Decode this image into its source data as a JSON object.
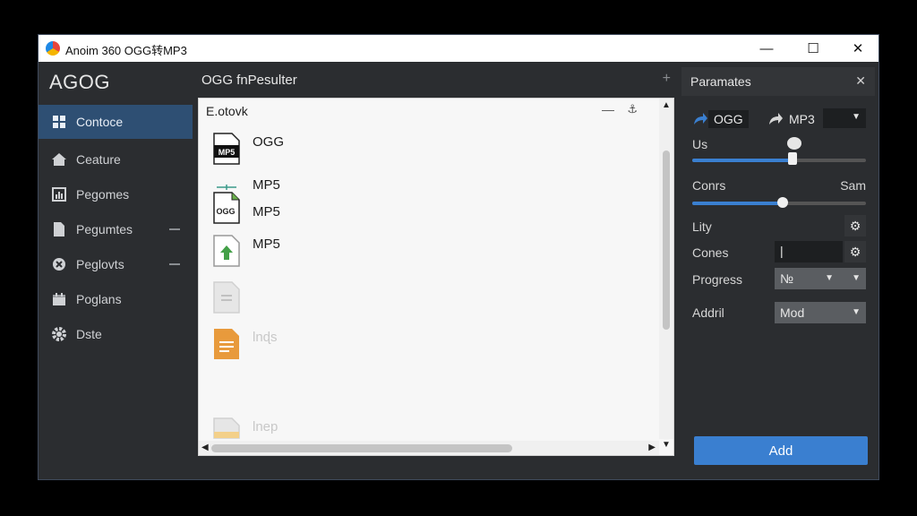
{
  "window": {
    "title": "Anoim 360 OGG转MP3",
    "minimize": "—",
    "maximize": "☐",
    "close": "✕"
  },
  "sidebar": {
    "logo": "AGOG",
    "items": [
      {
        "label": "Contoce",
        "icon": "grid-icon",
        "active": true
      },
      {
        "label": "Ceature",
        "icon": "home-icon"
      },
      {
        "label": "Pegomes",
        "icon": "chart-icon"
      },
      {
        "label": "Pegumtes",
        "icon": "document-icon",
        "dash": true
      },
      {
        "label": "Peglovts",
        "icon": "close-circle-icon",
        "dash": true
      },
      {
        "label": "Poglans",
        "icon": "calendar-icon"
      },
      {
        "label": "Dste",
        "icon": "gear-icon"
      }
    ]
  },
  "center": {
    "title": "OGG fnPesulter",
    "plus": "+",
    "panel": {
      "title": "E.otovk",
      "min": "—",
      "pin": "⚓",
      "files": [
        {
          "label": "OGG",
          "icon_text": "MP5",
          "icon": "mp5-file-icon"
        },
        {
          "label": "MP5",
          "icon": "divider-icon"
        },
        {
          "label": "MP5",
          "icon_text": "OGG",
          "icon": "ogg-file-icon"
        },
        {
          "label": "MP5",
          "icon": "upload-file-icon"
        },
        {
          "label": "",
          "icon": "faded-file-icon"
        },
        {
          "label": "lnɖs",
          "icon": "orange-document-icon"
        },
        {
          "label": "lnep",
          "icon": "folder-file-icon"
        }
      ]
    }
  },
  "params": {
    "title": "Paramates",
    "close": "✕",
    "source_format": "OGG",
    "target_format": "MP3",
    "labels": {
      "us": "Us",
      "conrs": "Conrs",
      "sam": "Sam",
      "lity": "Lity",
      "cones": "Cones",
      "progress": "Progress",
      "addril": "Addril"
    },
    "progress_value": "№",
    "addril_value": "Mod",
    "slider1": 0.58,
    "slider2": 0.52,
    "cones_value": "|",
    "add_button": "Add"
  }
}
